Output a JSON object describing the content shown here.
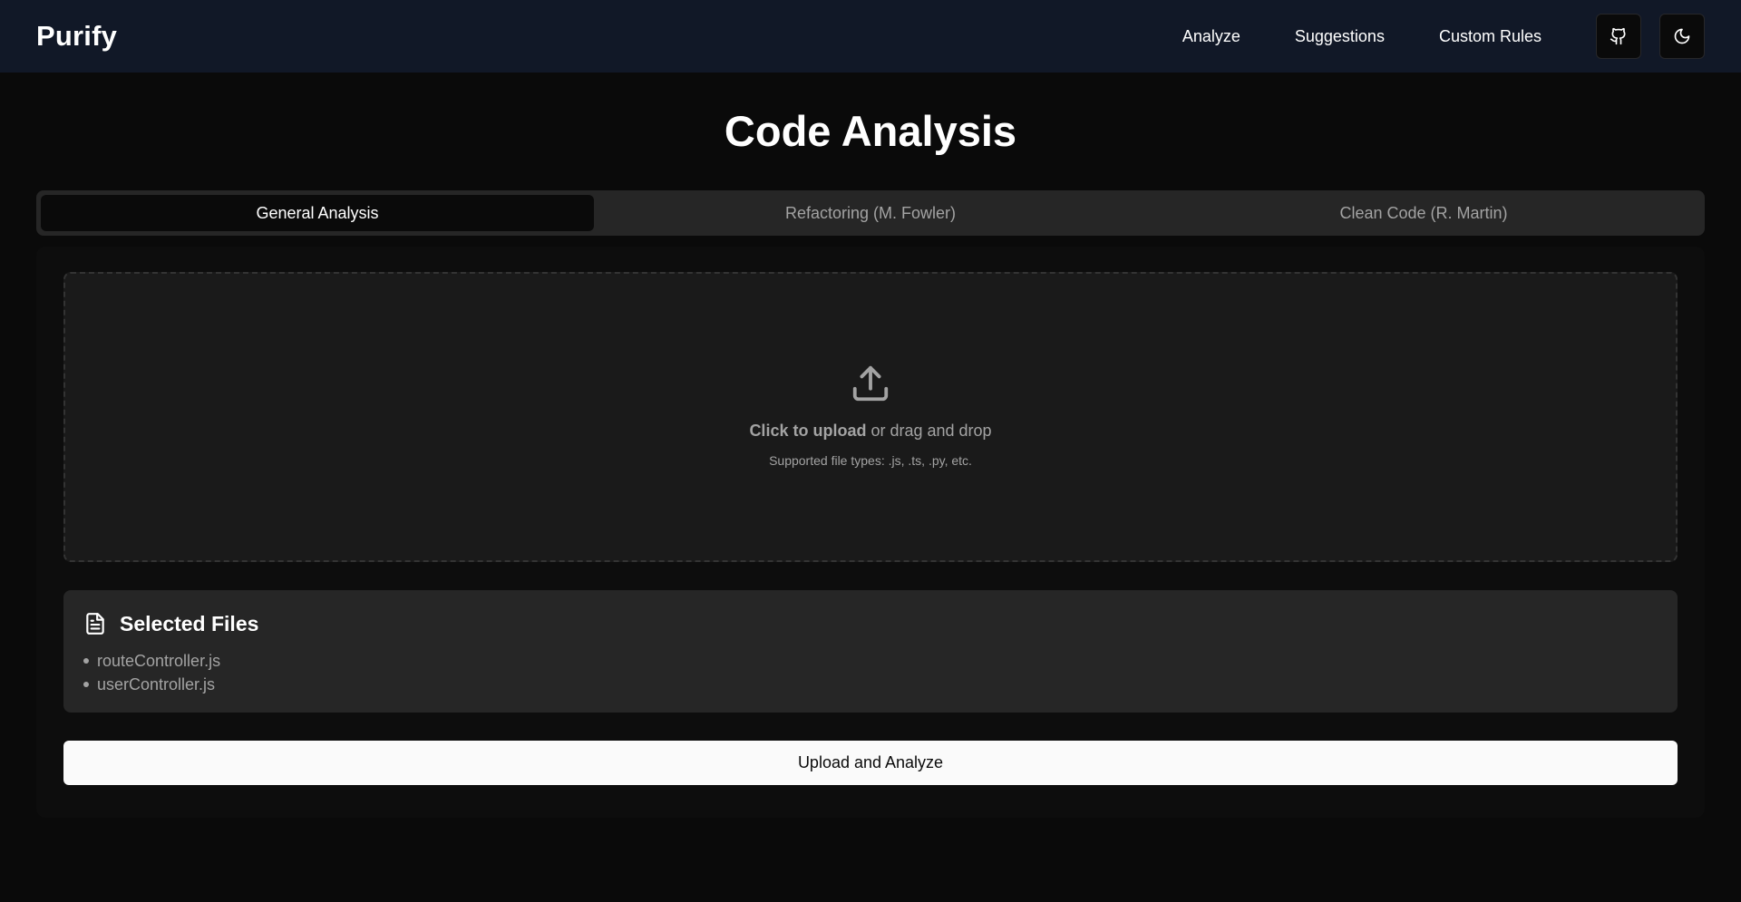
{
  "navbar": {
    "brand": "Purify",
    "links": [
      "Analyze",
      "Suggestions",
      "Custom Rules"
    ],
    "icons": [
      "github-icon",
      "moon-icon"
    ]
  },
  "page": {
    "title": "Code Analysis"
  },
  "tabs": [
    {
      "label": "General Analysis",
      "active": true
    },
    {
      "label": "Refactoring (M. Fowler)",
      "active": false
    },
    {
      "label": "Clean Code (R. Martin)",
      "active": false
    }
  ],
  "upload": {
    "icon": "upload-icon",
    "cta_bold": "Click to upload",
    "cta_rest": " or drag and drop",
    "hint": "Supported file types: .js, .ts, .py, etc."
  },
  "files": {
    "icon": "file-text-icon",
    "title": "Selected Files",
    "items": [
      "routeController.js",
      "userController.js"
    ]
  },
  "actions": {
    "submit_label": "Upload and Analyze"
  },
  "colors": {
    "background": "#0a0a0a",
    "navbar": "#111827",
    "surface": "#262626",
    "dropzone": "#1a1a1a",
    "primary_button": "#fafafa"
  }
}
